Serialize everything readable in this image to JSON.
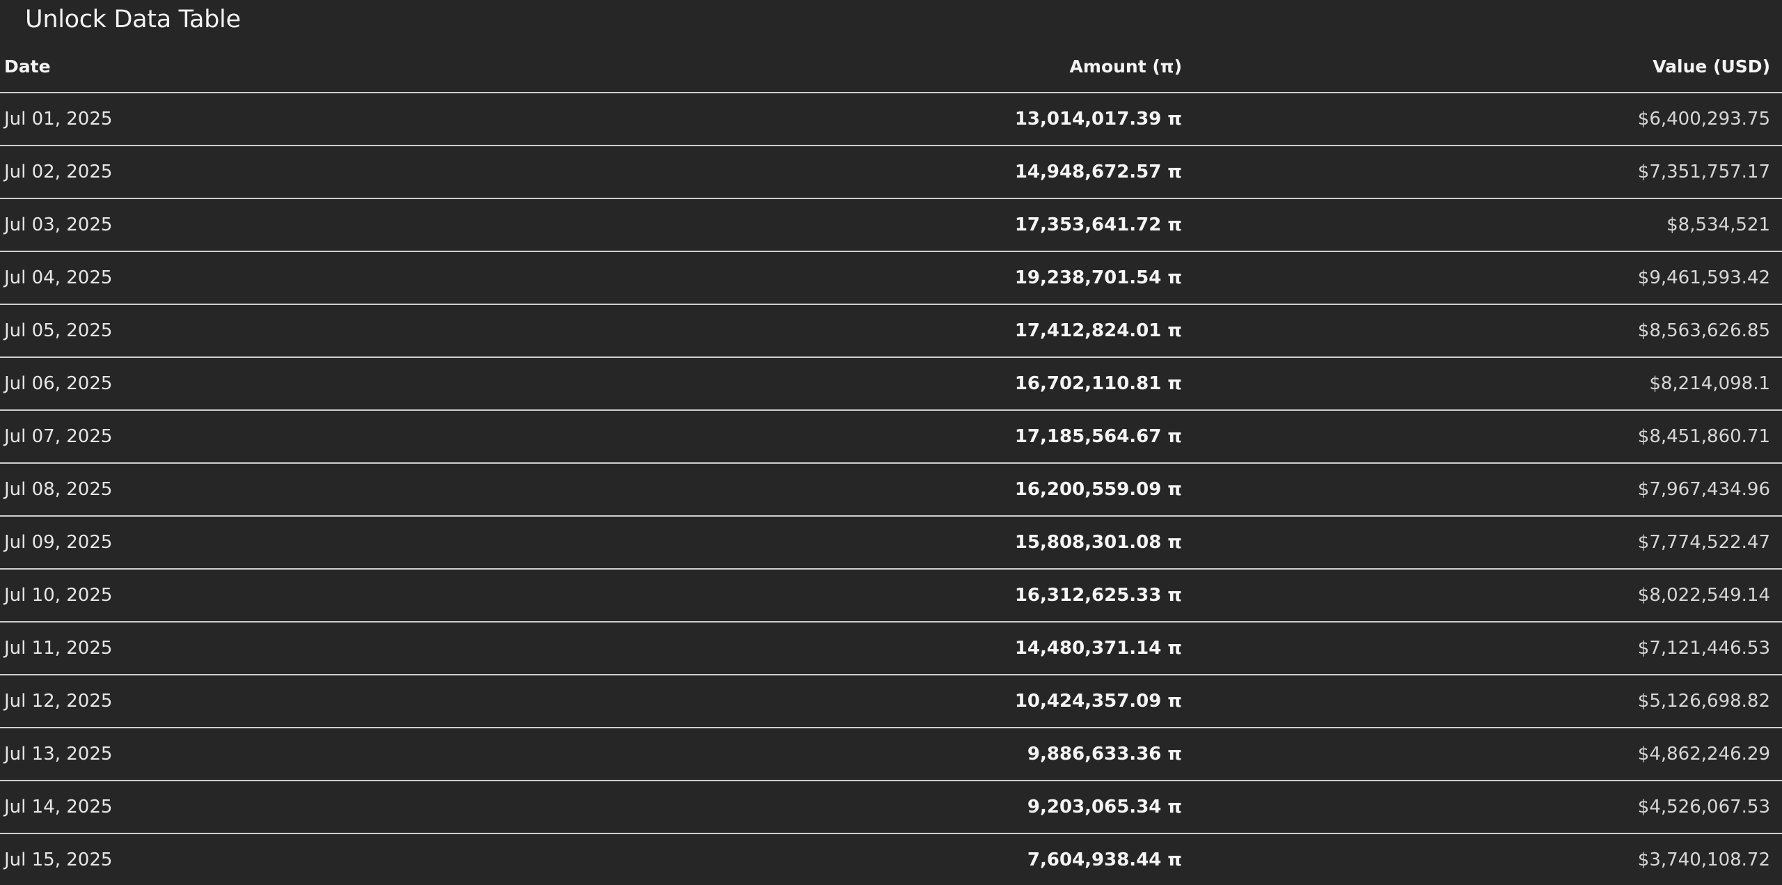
{
  "title": "Unlock Data Table",
  "table": {
    "headers": {
      "date": "Date",
      "amount": "Amount (π)",
      "value": "Value (USD)"
    },
    "rows": [
      {
        "date": "Jul 01, 2025",
        "amount": "13,014,017.39 π",
        "value": "$6,400,293.75"
      },
      {
        "date": "Jul 02, 2025",
        "amount": "14,948,672.57 π",
        "value": "$7,351,757.17"
      },
      {
        "date": "Jul 03, 2025",
        "amount": "17,353,641.72 π",
        "value": "$8,534,521"
      },
      {
        "date": "Jul 04, 2025",
        "amount": "19,238,701.54 π",
        "value": "$9,461,593.42"
      },
      {
        "date": "Jul 05, 2025",
        "amount": "17,412,824.01 π",
        "value": "$8,563,626.85"
      },
      {
        "date": "Jul 06, 2025",
        "amount": "16,702,110.81 π",
        "value": "$8,214,098.1"
      },
      {
        "date": "Jul 07, 2025",
        "amount": "17,185,564.67 π",
        "value": "$8,451,860.71"
      },
      {
        "date": "Jul 08, 2025",
        "amount": "16,200,559.09 π",
        "value": "$7,967,434.96"
      },
      {
        "date": "Jul 09, 2025",
        "amount": "15,808,301.08 π",
        "value": "$7,774,522.47"
      },
      {
        "date": "Jul 10, 2025",
        "amount": "16,312,625.33 π",
        "value": "$8,022,549.14"
      },
      {
        "date": "Jul 11, 2025",
        "amount": "14,480,371.14 π",
        "value": "$7,121,446.53"
      },
      {
        "date": "Jul 12, 2025",
        "amount": "10,424,357.09 π",
        "value": "$5,126,698.82"
      },
      {
        "date": "Jul 13, 2025",
        "amount": "9,886,633.36 π",
        "value": "$4,862,246.29"
      },
      {
        "date": "Jul 14, 2025",
        "amount": "9,203,065.34 π",
        "value": "$4,526,067.53"
      },
      {
        "date": "Jul 15, 2025",
        "amount": "7,604,938.44 π",
        "value": "$3,740,108.72"
      }
    ]
  }
}
